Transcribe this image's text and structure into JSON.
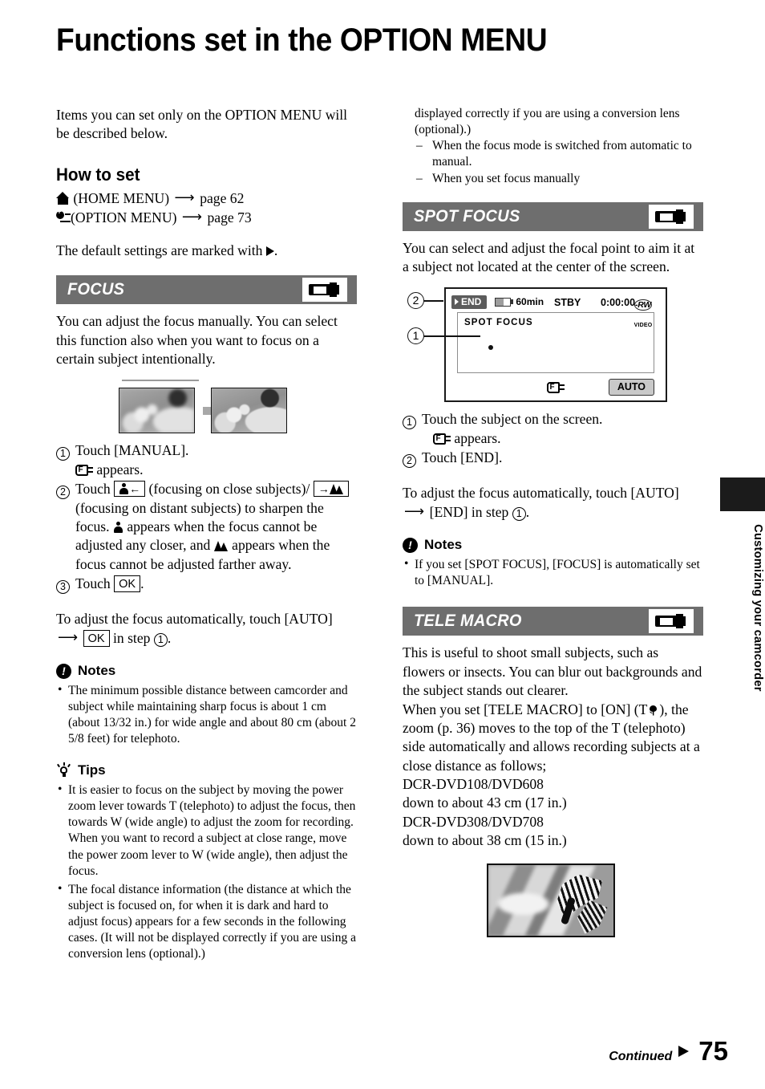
{
  "page": {
    "title": "Functions set in the OPTION MENU",
    "number": "75",
    "continued_label": "Continued",
    "side_tab_label": "Customizing your camcorder"
  },
  "intro": {
    "paragraph": "Items you can set only on the OPTION MENU will be described below."
  },
  "how_to_set": {
    "heading": "How to set",
    "home_menu_label": "(HOME MENU)",
    "home_menu_page": "page 62",
    "option_menu_label": "(OPTION MENU)",
    "option_menu_page": "page 73",
    "default_note_prefix": "The default settings are marked with",
    "default_note_suffix": "."
  },
  "focus": {
    "section_title": "FOCUS",
    "intro": "You can adjust the focus manually. You can select this function also when you want to focus on a certain subject intentionally.",
    "steps": [
      {
        "num": "1",
        "text": "Touch [MANUAL].",
        "sub": "appears."
      },
      {
        "num": "2",
        "text_a": "Touch",
        "btn_a": "close-subject",
        "text_b": "(focusing on close subjects)/",
        "btn_b": "distant-subject",
        "text_c": "(focusing on distant subjects) to sharpen the focus.",
        "text_d": "appears when the focus cannot be adjusted any closer, and",
        "text_e": "appears when the focus cannot be adjusted farther away."
      },
      {
        "num": "3",
        "text": "Touch",
        "btn": "OK",
        "text_end": "."
      }
    ],
    "auto_text_a": "To adjust the focus automatically, touch",
    "auto_text_b": "[AUTO]",
    "auto_btn": "OK",
    "auto_text_c": "in step",
    "auto_step": "1",
    "auto_text_d": ".",
    "notes_heading": "Notes",
    "notes": [
      "The minimum possible distance between camcorder and subject while maintaining sharp focus is about 1 cm (about 13/32 in.) for wide angle and about 80 cm (about 2 5/8 feet) for telephoto."
    ],
    "tips_heading": "Tips",
    "tips": [
      "It is easier to focus on the subject by moving the power zoom lever towards T (telephoto) to adjust the focus, then towards W (wide angle) to adjust the zoom for recording. When you want to record a subject at close range, move the power zoom lever to W (wide angle), then adjust the focus.",
      "The focal distance information (the distance at which the subject is focused on, for when it is dark and hard to adjust focus) appears for a few seconds in the following cases. (It will not be displayed correctly if you are using a conversion lens (optional).)"
    ],
    "tip_dashes": [
      "When the focus mode is switched from automatic to manual.",
      "When you set focus manually"
    ]
  },
  "spot_focus": {
    "section_title": "SPOT FOCUS",
    "intro": "You can select and adjust the focal point to aim it at a subject not located at the center of the screen.",
    "lcd": {
      "end_button": "END",
      "battery_time": "60min",
      "status": "STBY",
      "timecode": "0:00:00",
      "disc_format": "-RW",
      "disc_mode": "VIDEO",
      "screen_label": "SPOT FOCUS",
      "auto_button": "AUTO",
      "callout_1": "1",
      "callout_2": "2"
    },
    "steps": [
      {
        "num": "1",
        "text": "Touch the subject on the screen.",
        "sub": "appears."
      },
      {
        "num": "2",
        "text": "Touch [END]."
      }
    ],
    "auto_text_a": "To adjust the focus automatically, touch",
    "auto_text_b": "[AUTO]",
    "auto_text_c": "[END] in step",
    "auto_step": "1",
    "auto_text_d": ".",
    "notes_heading": "Notes",
    "notes": [
      "If you set [SPOT FOCUS], [FOCUS] is automatically set to [MANUAL]."
    ]
  },
  "tele_macro": {
    "section_title": "TELE MACRO",
    "paragraph_1": "This is useful to shoot small subjects, such as flowers or insects. You can blur out backgrounds and the subject stands out clearer.",
    "paragraph_2_a": "When you set [TELE MACRO] to [ON]",
    "paragraph_2_b": "(T",
    "paragraph_2_c": "), the zoom (p. 36) moves to the top of the T (telephoto) side automatically and allows recording subjects at a close distance as follows;",
    "models": [
      {
        "name": "DCR-DVD108/DVD608",
        "distance": "down to about 43 cm (17 in.)"
      },
      {
        "name": "DCR-DVD308/DVD708",
        "distance": "down to about 38 cm (15 in.)"
      }
    ]
  },
  "icons": {
    "home": "home-icon",
    "option": "option-menu-icon",
    "camcorder": "camcorder-icon",
    "focus": "focus-f-icon",
    "person": "person-icon",
    "mountain": "mountain-icon",
    "tulip": "tulip-macro-icon",
    "note": "note-exclamation-icon",
    "tip": "tip-lightbulb-icon",
    "arrow": "arrow-right-icon",
    "triangle": "triangle-right-icon"
  },
  "colors": {
    "section_bar": "#6e6e6e",
    "side_tab_block": "#1b1b1b",
    "lcd_end_button": "#5c5c5c",
    "lcd_auto_button": "#c9c9c9"
  }
}
